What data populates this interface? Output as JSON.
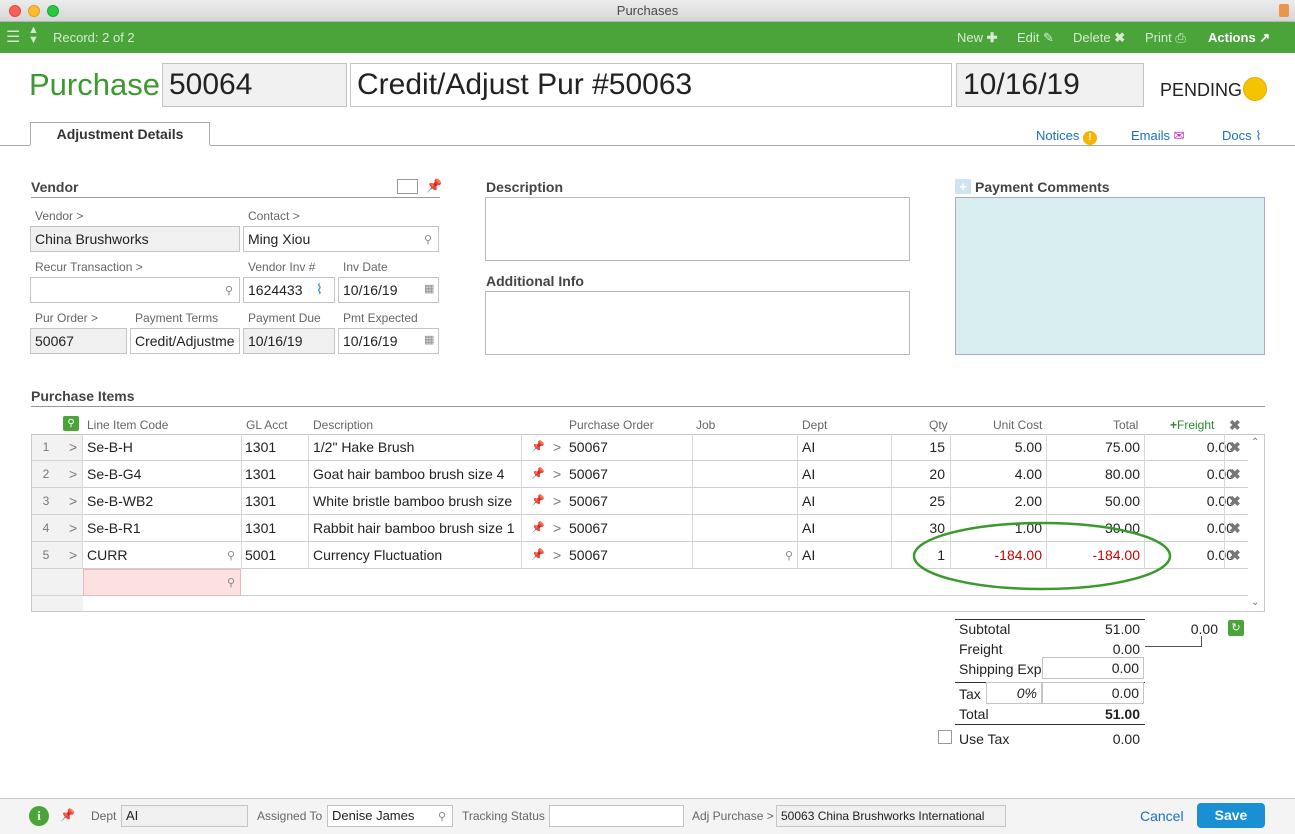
{
  "window": {
    "title": "Purchases"
  },
  "toolbar": {
    "record": "Record: 2 of 2",
    "new": "New",
    "edit": "Edit",
    "delete": "Delete",
    "print": "Print",
    "actions": "Actions"
  },
  "header": {
    "label": "Purchase:",
    "number": "50064",
    "title": "Credit/Adjust Pur #50063",
    "date": "10/16/19",
    "status": "PENDING"
  },
  "tabs": {
    "active": "Adjustment Details",
    "notices": "Notices",
    "emails": "Emails",
    "docs": "Docs"
  },
  "vendor": {
    "section": "Vendor",
    "vendor_label": "Vendor >",
    "vendor_value": "China Brushworks",
    "contact_label": "Contact >",
    "contact_value": "Ming Xiou",
    "recur_label": "Recur Transaction >",
    "recur_value": "",
    "vendor_inv_label": "Vendor Inv #",
    "vendor_inv_value": "1624433",
    "inv_date_label": "Inv Date",
    "inv_date_value": "10/16/19",
    "pur_order_label": "Pur Order >",
    "pur_order_value": "50067",
    "payment_terms_label": "Payment Terms",
    "payment_terms_value": "Credit/Adjustme",
    "payment_due_label": "Payment Due",
    "payment_due_value": "10/16/19",
    "pmt_expected_label": "Pmt Expected",
    "pmt_expected_value": "10/16/19"
  },
  "description": {
    "label": "Description",
    "additional_label": "Additional Info"
  },
  "payment_comments": {
    "label": "Payment Comments"
  },
  "items": {
    "section": "Purchase Items",
    "headers": {
      "code": "Line Item Code",
      "gl": "GL Acct",
      "desc": "Description",
      "po": "Purchase Order",
      "job": "Job",
      "dept": "Dept",
      "qty": "Qty",
      "unit": "Unit Cost",
      "total": "Total",
      "freight": "Freight"
    },
    "rows": [
      {
        "n": "1",
        "code": "Se-B-H",
        "gl": "1301",
        "desc": "1/2\" Hake Brush",
        "po": "50067",
        "job": "",
        "dept": "AI",
        "qty": "15",
        "unit": "5.00",
        "total": "75.00",
        "freight": "0.00"
      },
      {
        "n": "2",
        "code": "Se-B-G4",
        "gl": "1301",
        "desc": "Goat hair bamboo brush size 4",
        "po": "50067",
        "job": "",
        "dept": "AI",
        "qty": "20",
        "unit": "4.00",
        "total": "80.00",
        "freight": "0.00"
      },
      {
        "n": "3",
        "code": "Se-B-WB2",
        "gl": "1301",
        "desc": "White bristle bamboo brush size",
        "po": "50067",
        "job": "",
        "dept": "AI",
        "qty": "25",
        "unit": "2.00",
        "total": "50.00",
        "freight": "0.00"
      },
      {
        "n": "4",
        "code": "Se-B-R1",
        "gl": "1301",
        "desc": "Rabbit hair bamboo brush size 1",
        "po": "50067",
        "job": "",
        "dept": "AI",
        "qty": "30",
        "unit": "1.00",
        "total": "30.00",
        "freight": "0.00"
      },
      {
        "n": "5",
        "code": "CURR",
        "gl": "5001",
        "desc": "Currency Fluctuation",
        "po": "50067",
        "job": "",
        "dept": "AI",
        "qty": "1",
        "unit": "-184.00",
        "total": "-184.00",
        "freight": "0.00"
      }
    ]
  },
  "totals": {
    "subtotal_label": "Subtotal",
    "subtotal": "51.00",
    "freight_sum": "0.00",
    "freight_label": "Freight",
    "freight": "0.00",
    "shipping_label": "Shipping Exp",
    "shipping": "0.00",
    "tax_label": "Tax",
    "tax_rate": "0%",
    "tax": "0.00",
    "total_label": "Total",
    "total": "51.00",
    "use_tax_label": "Use Tax",
    "use_tax": "0.00"
  },
  "footer": {
    "dept_label": "Dept",
    "dept_value": "AI",
    "assigned_label": "Assigned To",
    "assigned_value": "Denise James",
    "tracking_label": "Tracking Status",
    "tracking_value": "",
    "adj_label": "Adj Purchase >",
    "adj_value": "50063 China Brushworks International",
    "cancel": "Cancel",
    "save": "Save"
  },
  "colors": {
    "brand_green": "#4aa43a",
    "title_green": "#3a9a2e",
    "status_yellow": "#f5c400",
    "link_blue": "#1a6fc4",
    "negative_red": "#d00000"
  }
}
